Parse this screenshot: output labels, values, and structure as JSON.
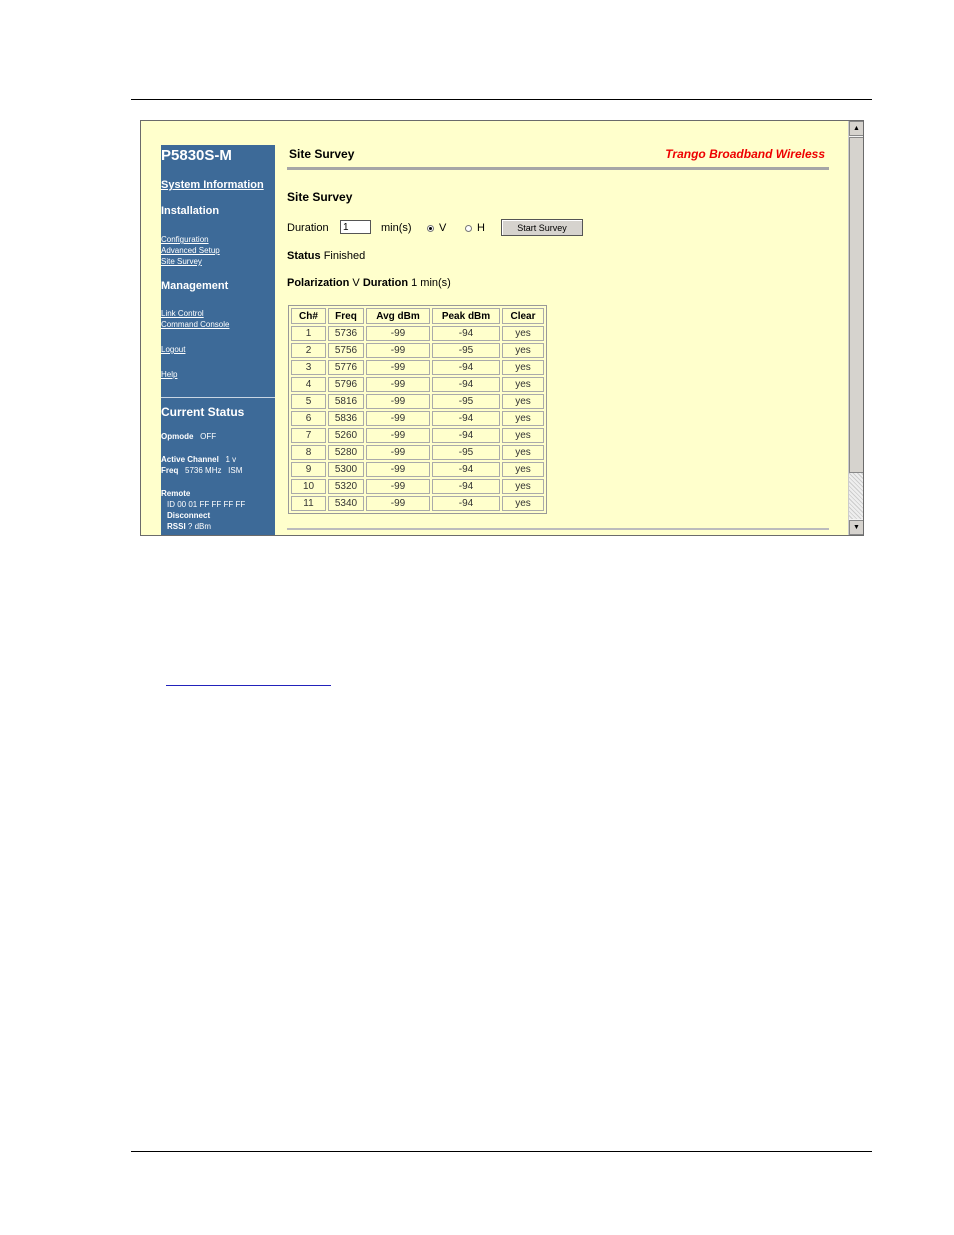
{
  "sidebar": {
    "model": "P5830S-M",
    "system_info": "System Information",
    "installation": "Installation",
    "installation_links": [
      "Configuration",
      "Advanced Setup",
      "Site Survey"
    ],
    "management": "Management",
    "management_links": [
      "Link Control",
      "Command Console"
    ],
    "logout": "Logout",
    "help": "Help",
    "current_status": {
      "title": "Current Status",
      "opmode_label": "Opmode",
      "opmode_value": "OFF",
      "active_channel_label": "Active Channel",
      "active_channel_value": "1 v",
      "freq_label": "Freq",
      "freq_value": "5736 MHz   ISM",
      "remote_label": "Remote",
      "remote_id": "ID 00 01 FF FF FF FF",
      "disconnect": "Disconnect",
      "rssi_label": "RSSI",
      "rssi_value": "? dBm"
    }
  },
  "header": {
    "title": "Site Survey",
    "brand": "Trango Broadband Wireless"
  },
  "survey": {
    "title": "Site Survey",
    "duration_label": "Duration",
    "duration_value": "1",
    "unit": "min(s)",
    "pol_v": "V",
    "pol_h": "H",
    "selected": "V",
    "start_button": "Start Survey",
    "status_label": "Status",
    "status_value": "Finished",
    "polarization_label": "Polarization",
    "polarization_value": "V",
    "duration2_label": "Duration",
    "duration2_value": "1 min(s)"
  },
  "table": {
    "headers": [
      "Ch#",
      "Freq",
      "Avg dBm",
      "Peak dBm",
      "Clear"
    ],
    "rows": [
      [
        "1",
        "5736",
        "-99",
        "-94",
        "yes"
      ],
      [
        "2",
        "5756",
        "-99",
        "-95",
        "yes"
      ],
      [
        "3",
        "5776",
        "-99",
        "-94",
        "yes"
      ],
      [
        "4",
        "5796",
        "-99",
        "-94",
        "yes"
      ],
      [
        "5",
        "5816",
        "-99",
        "-95",
        "yes"
      ],
      [
        "6",
        "5836",
        "-99",
        "-94",
        "yes"
      ],
      [
        "7",
        "5260",
        "-99",
        "-94",
        "yes"
      ],
      [
        "8",
        "5280",
        "-99",
        "-95",
        "yes"
      ],
      [
        "9",
        "5300",
        "-99",
        "-94",
        "yes"
      ],
      [
        "10",
        "5320",
        "-99",
        "-94",
        "yes"
      ],
      [
        "11",
        "5340",
        "-99",
        "-94",
        "yes"
      ]
    ]
  },
  "scrollbar": {
    "up_glyph": "▲",
    "down_glyph": "▼"
  }
}
